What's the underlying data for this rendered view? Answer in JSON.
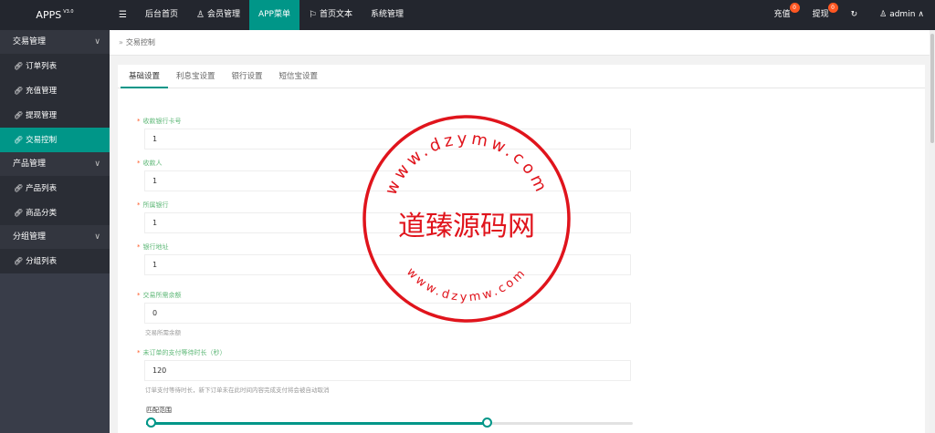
{
  "app": {
    "title": "APPS",
    "version": "V3.0"
  },
  "nav": [
    {
      "label": "",
      "icon": "menu-icon",
      "glyph": "☰"
    },
    {
      "label": "后台首页",
      "icon": "",
      "glyph": ""
    },
    {
      "label": "会员管理",
      "icon": "user-icon",
      "glyph": "♙"
    },
    {
      "label": "APP菜单",
      "icon": "",
      "glyph": "",
      "active": true
    },
    {
      "label": "首页文本",
      "icon": "flag-icon",
      "glyph": "⚐"
    },
    {
      "label": "系统管理",
      "icon": "",
      "glyph": ""
    }
  ],
  "right_nav": {
    "recharge_label": "充值",
    "recharge_badge": "0",
    "withdraw_label": "提现",
    "withdraw_badge": "0",
    "refresh_glyph": "↻",
    "user_label": "admin",
    "user_glyph": "♙",
    "caret_glyph": "∧"
  },
  "sidebar": {
    "groups": [
      {
        "label": "交易管理",
        "items": [
          "订单列表",
          "充值管理",
          "提现管理",
          "交易控制"
        ]
      },
      {
        "label": "产品管理",
        "items": [
          "产品列表",
          "商品分类"
        ]
      },
      {
        "label": "分组管理",
        "items": [
          "分组列表"
        ]
      }
    ],
    "active_item": "交易控制"
  },
  "breadcrumb": {
    "sep": "»",
    "text": "交易控制"
  },
  "tabs": [
    "基础设置",
    "利息宝设置",
    "银行设置",
    "短信宝设置"
  ],
  "form": {
    "fields": [
      {
        "label": "收款银行卡号",
        "value": "1",
        "hint": ""
      },
      {
        "label": "收款人",
        "value": "1",
        "hint": ""
      },
      {
        "label": "所属银行",
        "value": "1",
        "hint": ""
      },
      {
        "label": "银行地址",
        "value": "1",
        "hint": ""
      },
      {
        "label": "交易所需余额",
        "value": "0",
        "hint": "交易所需余额"
      },
      {
        "label": "未订单的支付等待时长（秒）",
        "value": "120",
        "hint": "订单支付等待时长，新下订单未在此时间内容完成支付将会被自动取消"
      }
    ],
    "range_label": "匹配范围",
    "range": {
      "low": 0,
      "high": 0.7
    }
  },
  "watermark": {
    "center_text": "道臻源码网",
    "ring_top": "www.dzymw.com",
    "ring_bottom": "www.dzymw.com"
  }
}
